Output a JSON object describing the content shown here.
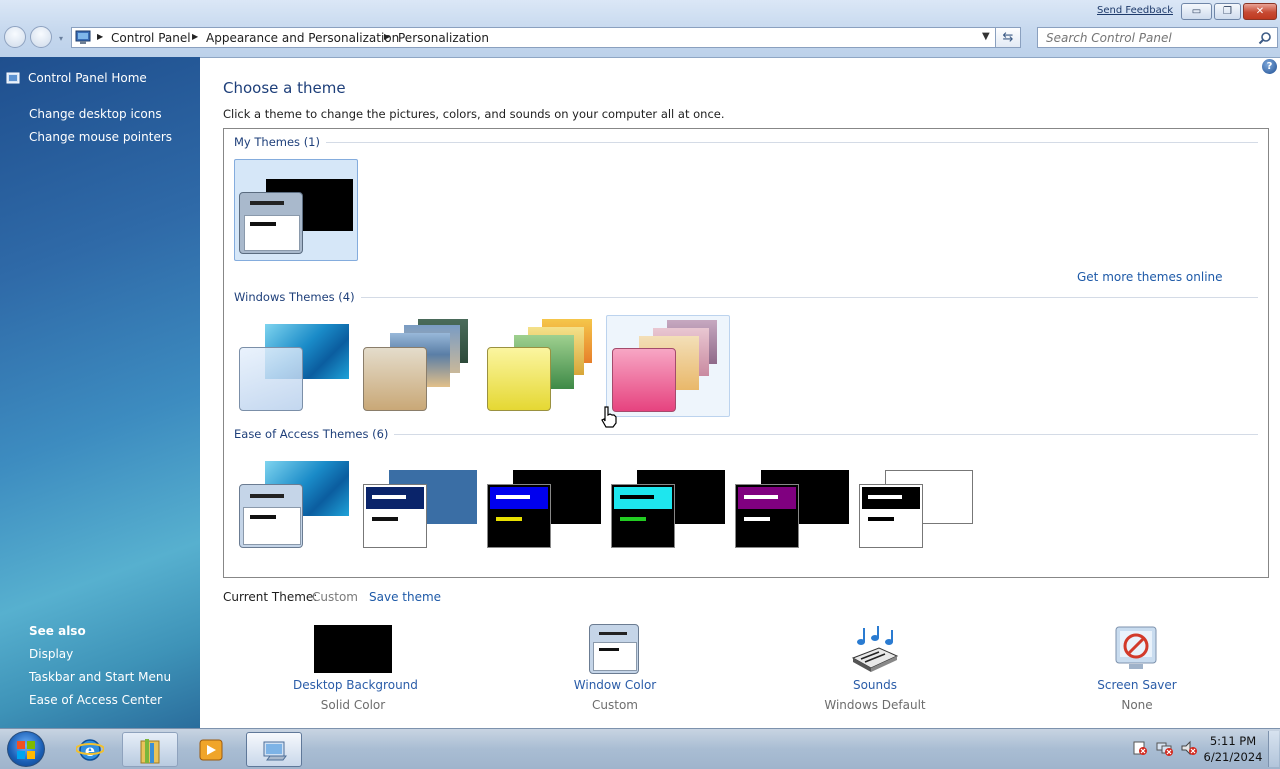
{
  "window": {
    "send_feedback": "Send Feedback",
    "minimize": "▭",
    "maximize": "❐",
    "close": "✕"
  },
  "address_bar": {
    "crumbs": [
      "Control Panel",
      "Appearance and Personalization",
      "Personalization"
    ],
    "search_placeholder": "Search Control Panel"
  },
  "sidebar": {
    "home": "Control Panel Home",
    "tasks": [
      "Change desktop icons",
      "Change mouse pointers"
    ],
    "see_also_heading": "See also",
    "see_also": [
      "Display",
      "Taskbar and Start Menu",
      "Ease of Access Center"
    ]
  },
  "main": {
    "title": "Choose a theme",
    "subtitle": "Click a theme to change the pictures, colors, and sounds on your computer all at once.",
    "groups": {
      "my_themes": "My Themes (1)",
      "windows_themes": "Windows Themes (4)",
      "ease_of_access": "Ease of Access Themes (6)"
    },
    "get_more_link": "Get more themes online",
    "current_theme_label": "Current Theme:",
    "current_theme_value": "Custom",
    "save_theme": "Save theme",
    "bottom_items": [
      {
        "label": "Desktop Background",
        "value": "Solid Color"
      },
      {
        "label": "Window Color",
        "value": "Custom"
      },
      {
        "label": "Sounds",
        "value": "Windows Default"
      },
      {
        "label": "Screen Saver",
        "value": "None"
      }
    ],
    "help": "?"
  },
  "taskbar": {
    "time": "5:11 PM",
    "date": "6/21/2024"
  }
}
